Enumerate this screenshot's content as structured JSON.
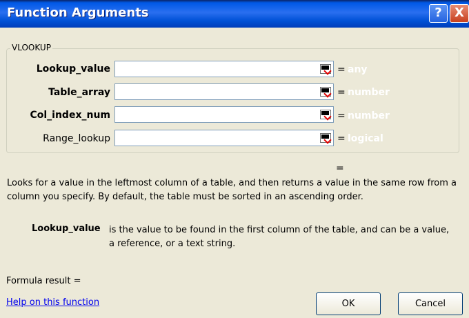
{
  "window": {
    "title": "Function Arguments",
    "help_glyph": "?",
    "close_glyph": "X"
  },
  "function_name": "VLOOKUP",
  "arguments": [
    {
      "label": "Lookup_value",
      "value": "",
      "equals": "=",
      "type_hint": "any",
      "bold": true
    },
    {
      "label": "Table_array",
      "value": "",
      "equals": "=",
      "type_hint": "number",
      "bold": true
    },
    {
      "label": "Col_index_num",
      "value": "",
      "equals": "=",
      "type_hint": "number",
      "bold": true
    },
    {
      "label": "Range_lookup",
      "value": "",
      "equals": "=",
      "type_hint": "logical",
      "bold": false
    }
  ],
  "function_result_equals": "=",
  "description": "Looks for a value in the leftmost column of a table, and then returns a value in the same row from a column you specify. By default, the table must be sorted in an ascending order.",
  "argument_help": {
    "name": "Lookup_value",
    "text": "is the value to be found in the first column of the table, and can be a value, a reference, or a text string."
  },
  "formula_result_label": "Formula result =",
  "help_link_text": "Help on this function",
  "buttons": {
    "ok": "OK",
    "cancel": "Cancel"
  },
  "colors": {
    "titlebar": "#0058e6",
    "dialog_bg": "#ece9d8",
    "link": "#0000ee",
    "field_border": "#7f9db9"
  },
  "icons": [
    "help-icon",
    "close-icon",
    "collapse-dialog-icon"
  ]
}
